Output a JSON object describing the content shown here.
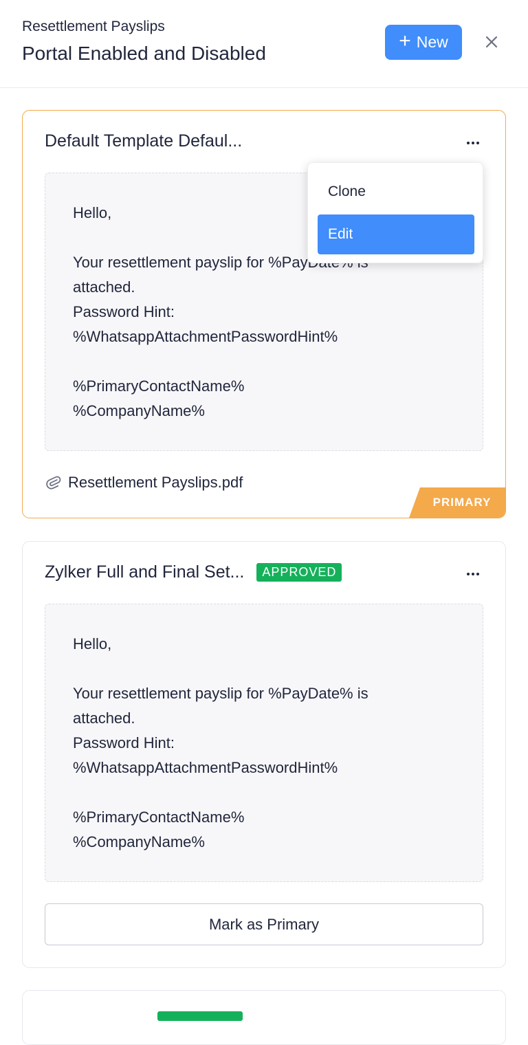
{
  "header": {
    "subtitle": "Resettlement Payslips",
    "title": "Portal Enabled and Disabled",
    "new_label": "New"
  },
  "colors": {
    "accent": "#408dfb",
    "primary_badge": "#f4a94b",
    "approved_badge": "#15b15a"
  },
  "cards": [
    {
      "title": "Default Template Defaul...",
      "message_lines": [
        "Hello,",
        "",
        "Your resettlement payslip for %PayDate% is",
        "attached.",
        "Password Hint:",
        "%WhatsappAttachmentPasswordHint%",
        "",
        "%PrimaryContactName%",
        "%CompanyName%"
      ],
      "attachment": "Resettlement Payslips.pdf",
      "ribbon": "PRIMARY"
    },
    {
      "title": "Zylker Full and Final Set...",
      "badge": "APPROVED",
      "message_lines": [
        "Hello,",
        "",
        "Your resettlement payslip for %PayDate% is",
        "attached.",
        "Password Hint:",
        "%WhatsappAttachmentPasswordHint%",
        "",
        "%PrimaryContactName%",
        "%CompanyName%"
      ],
      "action_label": "Mark as Primary"
    }
  ],
  "dropdown": {
    "items": [
      "Clone",
      "Edit"
    ],
    "active": "Edit"
  }
}
